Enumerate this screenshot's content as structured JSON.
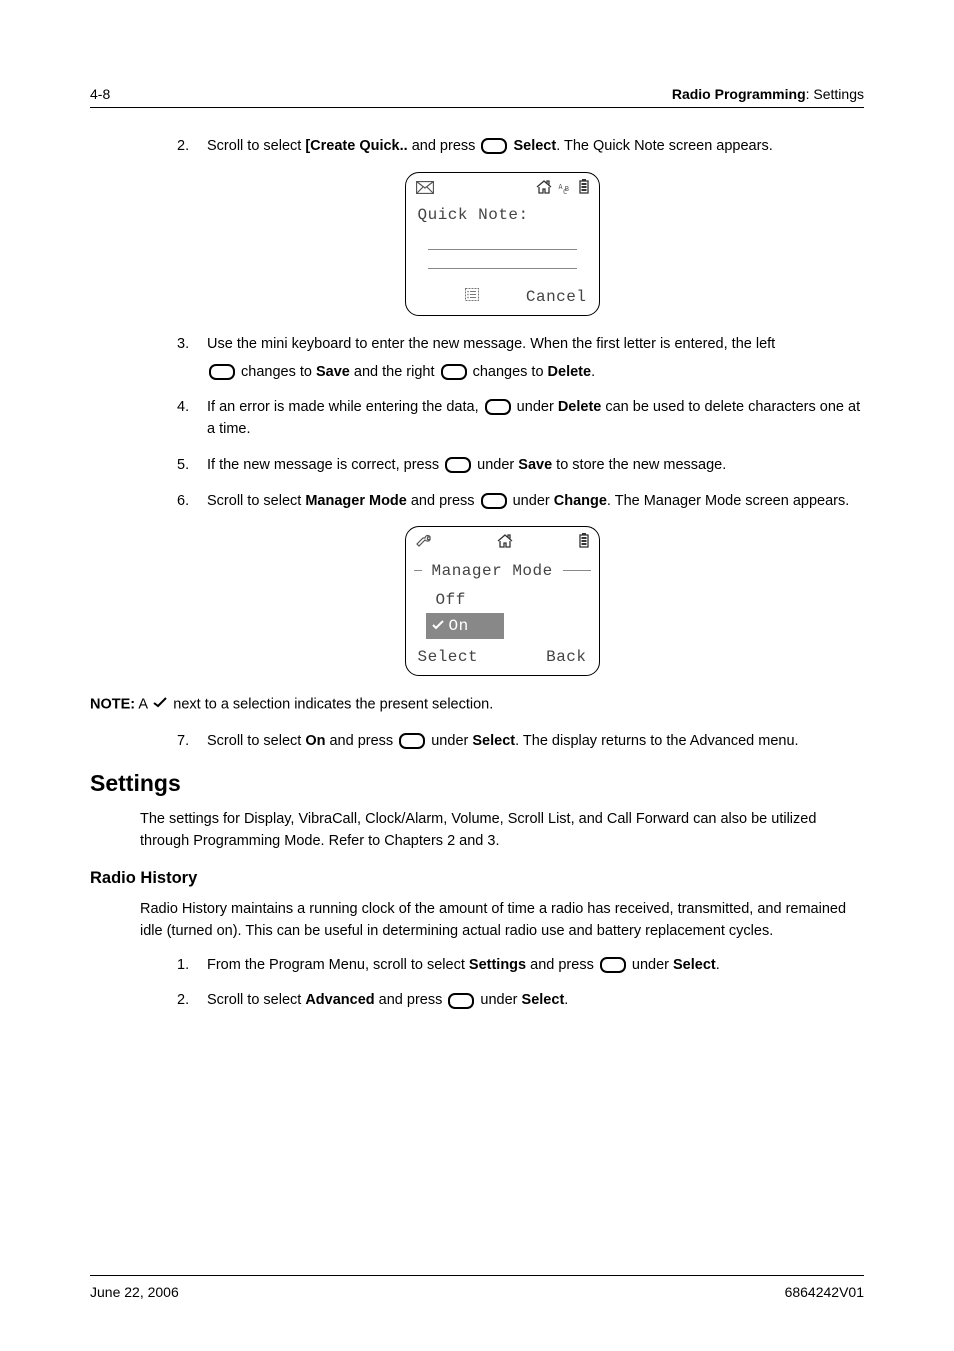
{
  "header": {
    "page_num": "4-8",
    "chapter_bold": "Radio Programming",
    "chapter_rest": ": Settings"
  },
  "steps_a": [
    {
      "num": "2.",
      "parts": [
        "Scroll to select ",
        "[Create Quick..",
        " and press ",
        "Select",
        ". The Quick Note screen appears."
      ]
    }
  ],
  "screen1": {
    "title": "Quick Note:",
    "right_soft": "Cancel"
  },
  "steps_b": [
    {
      "num": "3.",
      "line1_parts": [
        "Use the mini keyboard to enter the new message. When the first letter is entered, the left "
      ],
      "line2_parts": [
        " changes to ",
        "Save",
        " and the right ",
        " changes to ",
        "Delete",
        "."
      ]
    },
    {
      "num": "4.",
      "parts": [
        "If an error is made while entering the data, ",
        " under ",
        "Delete",
        " can be used to delete characters one at a time."
      ]
    },
    {
      "num": "5.",
      "parts": [
        "If the new message is correct, press ",
        " under ",
        "Save",
        " to store the new message."
      ]
    },
    {
      "num": "6.",
      "parts": [
        "Scroll to select ",
        "Manager Mode",
        " and press ",
        " under ",
        "Change",
        ". The Manager Mode screen appears."
      ]
    }
  ],
  "screen2": {
    "legend": "Manager Mode",
    "opt_off": "Off",
    "opt_on": "On",
    "left_soft": "Select",
    "right_soft": "Back"
  },
  "note": {
    "label": "NOTE:",
    "text_before": " A ",
    "text_after": " next to a selection indicates the present selection."
  },
  "steps_c": [
    {
      "num": "7.",
      "parts": [
        "Scroll to select ",
        "On",
        " and press ",
        " under ",
        "Select",
        ". The display returns to the Advanced menu."
      ]
    }
  ],
  "settings": {
    "heading": "Settings",
    "para": "The settings for Display, VibraCall, Clock/Alarm, Volume, Scroll List, and Call Forward can also be utilized through Programming Mode. Refer to Chapters 2 and 3."
  },
  "radio_history": {
    "heading": "Radio History",
    "para": "Radio History maintains a running clock of the amount of time a radio has received, transmitted, and remained idle (turned on). This can be useful in determining actual radio use and battery replacement cycles."
  },
  "steps_d": [
    {
      "num": "1.",
      "parts": [
        "From the Program Menu, scroll to select ",
        "Settings",
        " and press ",
        " under ",
        "Select",
        "."
      ]
    },
    {
      "num": "2.",
      "parts": [
        "Scroll to select ",
        "Advanced",
        " and press ",
        " under ",
        "Select",
        "."
      ]
    }
  ],
  "footer": {
    "date": "June 22, 2006",
    "code": "6864242V01"
  }
}
